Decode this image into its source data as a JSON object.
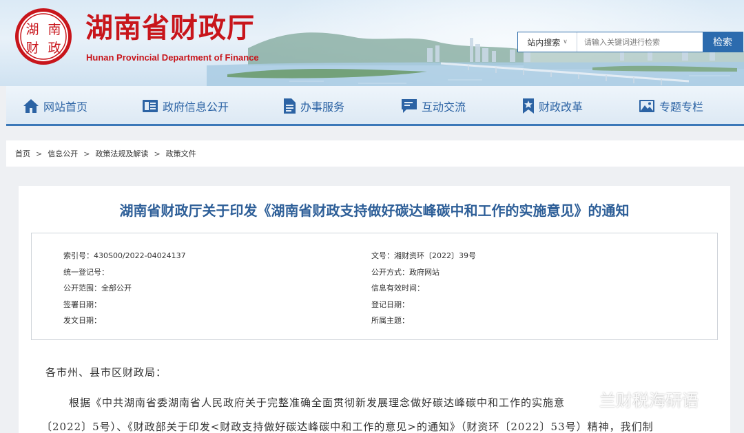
{
  "header": {
    "logo_text": "湖南财政",
    "title": "湖南省财政厅",
    "subtitle": "Hunan Provincial Department of Finance"
  },
  "search": {
    "scope_label": "站内搜索",
    "placeholder": "请输入关键词进行检索",
    "button_label": "检索"
  },
  "nav": {
    "items": [
      {
        "label": "网站首页",
        "icon": "home-icon"
      },
      {
        "label": "政府信息公开",
        "icon": "document-list-icon"
      },
      {
        "label": "办事服务",
        "icon": "file-icon"
      },
      {
        "label": "互动交流",
        "icon": "chat-icon"
      },
      {
        "label": "财政改革",
        "icon": "bookmark-star-icon"
      },
      {
        "label": "专题专栏",
        "icon": "image-icon"
      }
    ]
  },
  "breadcrumb": {
    "items": [
      "首页",
      "信息公开",
      "政策法规及解读",
      "政策文件"
    ],
    "separator": ">"
  },
  "article": {
    "title": "湖南省财政厅关于印发《湖南省财政支持做好碳达峰碳中和工作的实施意见》的通知",
    "meta": {
      "index_no": "索引号：430S00/2022-04024137",
      "unified_reg_no": "统一登记号：",
      "public_scope": "公开范围：全部公开",
      "sign_date": "签署日期：",
      "issue_date": "发文日期：",
      "doc_no": "文号：湘财资环〔2022〕39号",
      "public_method": "公开方式：政府网站",
      "valid_time": "信息有效时间：",
      "reg_date": "登记日期：",
      "subject": "所属主题："
    },
    "salutation": "各市州、县市区财政局：",
    "para_line1": "根据《中共湖南省委湖南省人民政府关于完整准确全面贯彻新发展理念做好碳达峰碳中和工作的实施意",
    "para_line2": "〔2022〕5号）、《财政部关于印发<财政支持做好碳达峰碳中和工作的意见>的通知》（财资环〔2022〕53号）精神，我们制"
  },
  "watermark": {
    "text": "兰财税海研语"
  },
  "colors": {
    "brand_red": "#c8151b",
    "nav_blue": "#2c63a4",
    "title_blue": "#2e5f98",
    "search_blue": "#2c6bae"
  }
}
